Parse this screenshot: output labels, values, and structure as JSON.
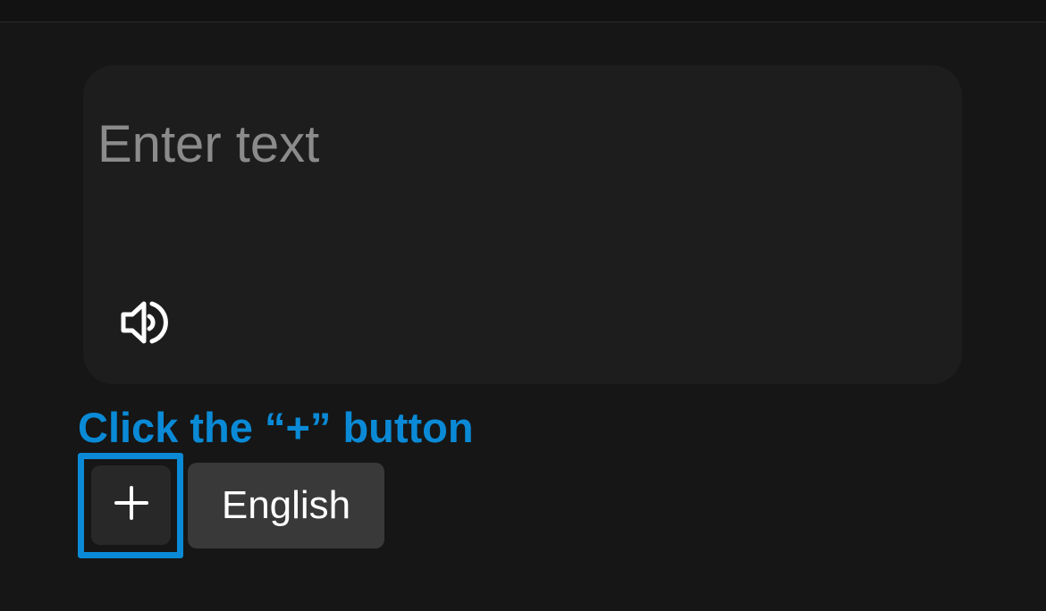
{
  "input": {
    "value": "",
    "placeholder": "Enter text"
  },
  "speaker": {
    "icon": "speaker-icon"
  },
  "instruction": {
    "text": "Click the “+” button"
  },
  "add_button": {
    "icon": "plus-icon"
  },
  "language_button": {
    "label": "English"
  },
  "colors": {
    "background": "#161616",
    "card": "#1d1d1d",
    "accent": "#0a8ad6",
    "placeholder": "#8b8b8b",
    "language_button_bg": "#393939",
    "plus_button_bg": "#282828"
  }
}
